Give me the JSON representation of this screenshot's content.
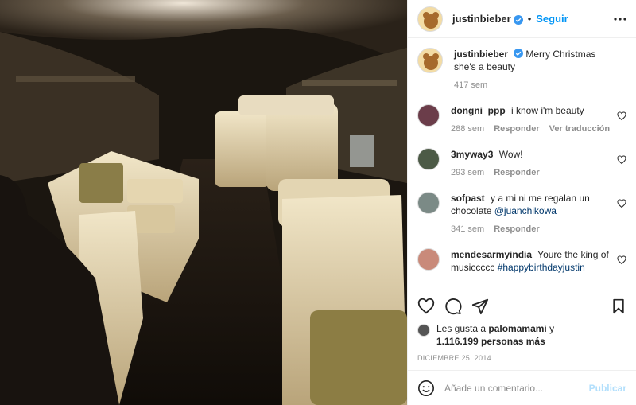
{
  "post": {
    "author": "justinbieber",
    "follow_label": "Seguir",
    "separator": "•",
    "photo_alt": "Interior of a private jet cabin with cream leather seats",
    "caption_text": "Merry Christmas she's a beauty",
    "caption_time": "417 sem"
  },
  "comments": [
    {
      "user": "dongni_ppp",
      "text": "i know i'm beauty",
      "time": "288 sem",
      "reply": "Responder",
      "translate": "Ver traducción"
    },
    {
      "user": "3myway3",
      "text": "Wow!",
      "time": "293 sem",
      "reply": "Responder"
    },
    {
      "user": "sofpast",
      "text": "y a mi ni me regalan un chocolate",
      "mention": "@juanchikowa",
      "time": "341 sem",
      "reply": "Responder"
    },
    {
      "user": "mendesarmyindia",
      "text": "Youre the king of musiccccc",
      "mention": "#happybirthdayjustin"
    }
  ],
  "likes": {
    "prefix": "Les gusta a",
    "first_user": "palomamami",
    "connector": "y",
    "count_text": "1.116.199 personas más"
  },
  "date": "DICIEMBRE 25, 2014",
  "add_comment": {
    "placeholder": "Añade un comentario...",
    "publish_label": "Publicar"
  },
  "icons": [
    "verified-badge-icon",
    "more-options-icon",
    "heart-icon",
    "comment-icon",
    "share-icon",
    "bookmark-icon",
    "emoji-icon"
  ],
  "colors": {
    "accent": "#0095f6",
    "publish_disabled": "#b2dffc",
    "verified": "#3897f0",
    "link": "#00376b"
  }
}
